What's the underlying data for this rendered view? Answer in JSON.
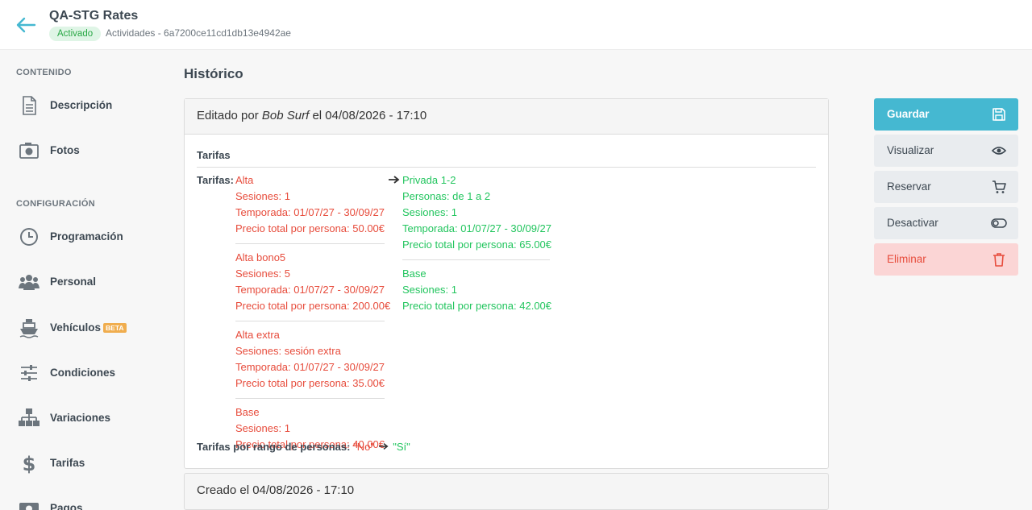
{
  "header": {
    "title": "QA-STG Rates",
    "status": "Activado",
    "subtitle": "Actividades - 6a7200ce11cd1db13e4942ae"
  },
  "sidebar": {
    "section_content": "CONTENIDO",
    "section_config": "CONFIGURACIÓN",
    "items": [
      {
        "label": "Descripción",
        "icon": "document-icon"
      },
      {
        "label": "Fotos",
        "icon": "photo-icon"
      },
      {
        "label": "Programación",
        "icon": "clock-icon"
      },
      {
        "label": "Personal",
        "icon": "people-icon"
      },
      {
        "label": "Vehículos",
        "icon": "boat-icon",
        "badge": "BETA"
      },
      {
        "label": "Condiciones",
        "icon": "sliders-icon"
      },
      {
        "label": "Variaciones",
        "icon": "sitemap-icon"
      },
      {
        "label": "Tarifas",
        "icon": "dollar-icon"
      },
      {
        "label": "Pagos",
        "icon": "payment-icon"
      }
    ]
  },
  "main": {
    "title": "Histórico",
    "entry": {
      "prefix": "Editado por",
      "author": "Bob Surf",
      "date_text": "el 04/08/2026 - 17:10",
      "section": "Tarifas",
      "field_label": "Tarifas:",
      "old_rates": [
        [
          "Alta",
          "Sesiones: 1",
          "Temporada: 01/07/27 - 30/09/27",
          "Precio total por persona: 50.00€"
        ],
        [
          "Alta bono5",
          "Sesiones: 5",
          "Temporada: 01/07/27 - 30/09/27",
          "Precio total por persona: 200.00€"
        ],
        [
          "Alta extra",
          "Sesiones: sesión extra",
          "Temporada: 01/07/27 - 30/09/27",
          "Precio total por persona: 35.00€"
        ],
        [
          "Base",
          "Sesiones: 1",
          "Precio total por persona: 40.00€"
        ]
      ],
      "new_rates": [
        [
          "Privada 1-2",
          "Personas: de 1 a 2",
          "Sesiones: 1",
          "Temporada: 01/07/27 - 30/09/27",
          "Precio total por persona: 65.00€"
        ],
        [
          "Base",
          "Sesiones: 1",
          "Precio total por persona: 42.00€"
        ]
      ],
      "range_label": "Tarifas por rango de personas:",
      "range_old": "\"No\"",
      "range_new": "\"Sí\""
    },
    "created": "Creado el 04/08/2026 - 17:10"
  },
  "actions": {
    "save": "Guardar",
    "view": "Visualizar",
    "book": "Reservar",
    "deactivate": "Desactivar",
    "delete": "Eliminar"
  },
  "colors": {
    "accent": "#45b8d1",
    "removed": "#e74c3c",
    "added": "#22c55e",
    "danger_bg": "#fbd5d5"
  }
}
